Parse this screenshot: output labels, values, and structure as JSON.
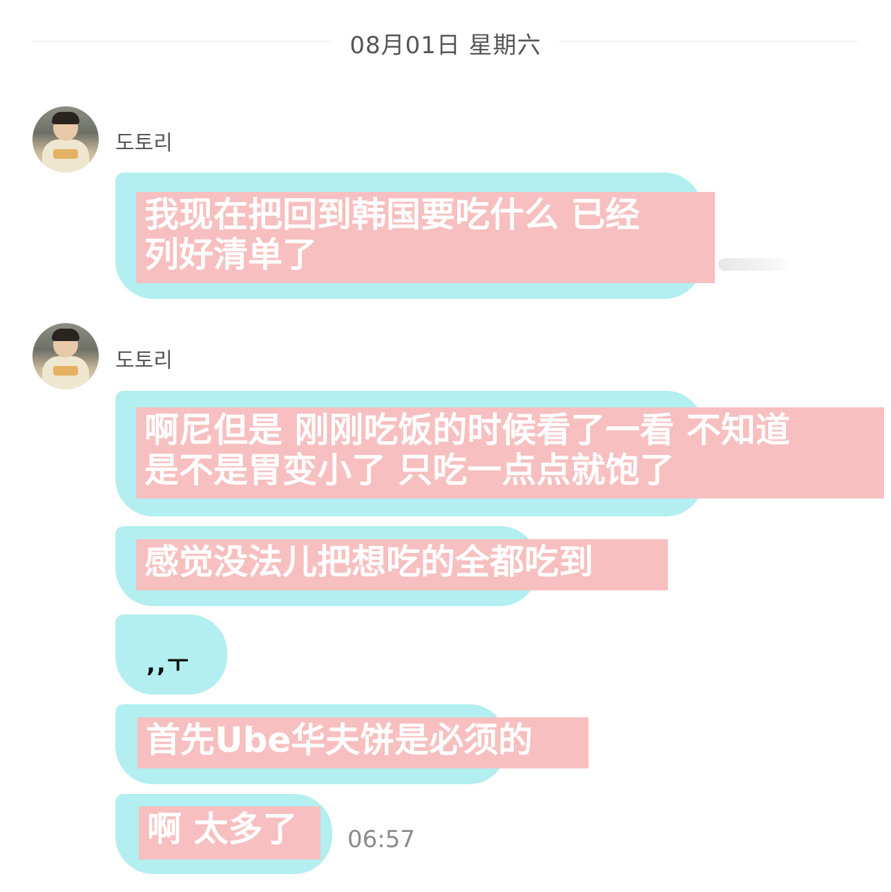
{
  "date_separator": "08月01日 星期六",
  "messages": [
    {
      "sender": "도토리",
      "lines": [
        "我现在把回到韩国要吃什么 已经",
        "列好清单了"
      ]
    },
    {
      "sender": "도토리",
      "lines": [
        "啊尼但是 刚刚吃饭的时候看了一看 不知道",
        "是不是胃变小了 只吃一点点就饱了"
      ]
    },
    {
      "lines": [
        "感觉没法儿把想吃的全都吃到"
      ]
    },
    {
      "text": ",,ㅜ"
    },
    {
      "lines": [
        "首先Ube华夫饼是必须的"
      ]
    },
    {
      "lines": [
        "啊 太多了"
      ],
      "time": "06:57"
    }
  ],
  "colors": {
    "bubble": "#b3eef0",
    "highlight": "#f7bfbf",
    "highlight_text": "#ffffff",
    "time_text": "#8a8a8a"
  }
}
